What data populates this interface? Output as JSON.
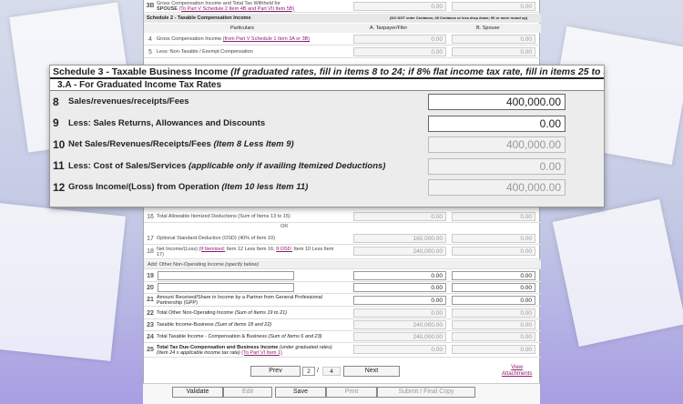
{
  "top_row": {
    "num": "3B",
    "label_line1": "Gross Compensation Income and Total Tax Withheld for",
    "label_line2": "SPOUSE",
    "label_link": "(To Part V Schedule 2 Item 4B and Part VII Item 5B)",
    "val_a": "0.00",
    "val_b": "0.00"
  },
  "schedule2": {
    "title": "Schedule 2 - Taxable Compensation Income",
    "note": "(DO NOT enter Centavos; 49 Centavos or less drop down; 50 or more round up)",
    "col_particulars": "Particulars",
    "col_a": "A. Taxpayer/Filer",
    "col_b": "B. Spouse",
    "item4_num": "4",
    "item4_label": "Gross Compensation Income",
    "item4_link": "(from Part V Schedule 1 Item 3A or 3B)",
    "item4_a": "0.00",
    "item4_b": "0.00",
    "item5_num": "5",
    "item5_label": "Less: Non-Taxable / Exempt Compensation",
    "item5_a": "0.00",
    "item5_b": "0.00"
  },
  "panel": {
    "title_main": "Schedule 3 - Taxable Business Income",
    "title_italic": "(If graduated rates, fill in items 8 to 24; if 8% flat income tax rate, fill in items 25 to 30)",
    "subtitle": "3.A - For Graduated Income Tax Rates",
    "rows": [
      {
        "num": "8",
        "label": "Sales/revenues/receipts/Fees",
        "italic": "",
        "value": "400,000.00"
      },
      {
        "num": "9",
        "label": "Less: Sales Returns, Allowances and Discounts",
        "italic": "",
        "value": "0.00"
      },
      {
        "num": "10",
        "label": "Net Sales/Revenues/Receipts/Fees",
        "italic": "(Item 8 Less Item 9)",
        "value": "400,000.00"
      },
      {
        "num": "11",
        "label": "Less: Cost of Sales/Services",
        "italic": "(applicable only if availing Itemized Deductions)",
        "value": "0.00"
      },
      {
        "num": "12",
        "label": "Gross Income/(Loss) from Operation",
        "italic": "(Item 10 less Item 11)",
        "value": "400,000.00"
      }
    ]
  },
  "form": {
    "item16_num": "16",
    "item16_label": "Total Allowable Itemized Deductions (Sum of Items 13 to 15)",
    "item16_a": "0.00",
    "item16_b": "0.00",
    "or_label": "OR",
    "item17_num": "17",
    "item17_label": "Optional Standard Deduction (OSD) (40% of Item 10)",
    "item17_a": "160,000.00",
    "item17_b": "0.00",
    "item18_num": "18",
    "item18_label1": "Net Income/(Loss)",
    "item18_link1": "(If Itemized:",
    "item18_label2": "Item 12 Less Item 16;",
    "item18_link2": "If OSD:",
    "item18_label3": "Item 10 Less Item",
    "item18_label4": "17)",
    "item18_a": "240,000.00",
    "item18_b": "0.00",
    "add_label": "Add: Other Non-Operating Income",
    "add_italic": "(specify below)",
    "item19_num": "19",
    "item19_a": "0.00",
    "item19_b": "0.00",
    "item20_num": "20",
    "item20_a": "0.00",
    "item20_b": "0.00",
    "item21_num": "21",
    "item21_label1": "Amount Received/Share in Income by a Partner from General Professional",
    "item21_label2": "Partnership (GPP)",
    "item21_a": "0.00",
    "item21_b": "0.00",
    "item22_num": "22",
    "item22_label": "Total Other Non-Operating Income",
    "item22_italic": "(Sum of Items 19 to 21)",
    "item22_a": "0.00",
    "item22_b": "0.00",
    "item23_num": "23",
    "item23_label": "Taxable Income-Business",
    "item23_italic": "(Sum of Items 18 and 22)",
    "item23_a": "240,000.00",
    "item23_b": "0.00",
    "item24_num": "24",
    "item24_label": "Total Taxable Income - Compensation & Business",
    "item24_italic": "(Sum of Items 6 and 23)",
    "item24_a": "240,000.00",
    "item24_b": "0.00",
    "item25_num": "25",
    "item25_label1": "Total Tax Due-Compensation and Business Income",
    "item25_italic1": "(under graduated rates)",
    "item25_label2": "(Item 24 x applicable income tax rate)",
    "item25_link": "(To Part VI Item 1)",
    "item25_a": "0.00",
    "item25_b": "0.00"
  },
  "nav": {
    "prev": "Prev",
    "page": "2",
    "sep": "/",
    "total": "4",
    "next": "Next",
    "view_attachments_1": "View",
    "view_attachments_2": "Attachments"
  },
  "toolbar": {
    "validate": "Validate",
    "edit": "Edit",
    "save": "Save",
    "print": "Print",
    "submit": "Submit / Final Copy"
  }
}
